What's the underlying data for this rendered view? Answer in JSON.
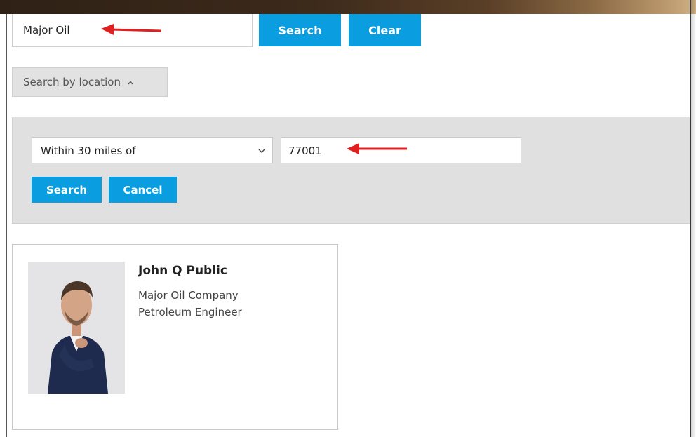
{
  "search": {
    "keyword_value": "Major Oil",
    "search_label": "Search",
    "clear_label": "Clear"
  },
  "location": {
    "toggle_label": "Search by location",
    "distance_selected": "Within 30 miles of",
    "zip_value": "77001",
    "search_label": "Search",
    "cancel_label": "Cancel"
  },
  "results": [
    {
      "name": "John Q Public",
      "company": "Major Oil Company",
      "title": "Petroleum Engineer"
    }
  ],
  "icons": {
    "toggle_icon": "caret-up-icon",
    "select_icon": "chevron-down-icon",
    "annotation_arrow": "red-arrow-icon"
  },
  "colors": {
    "primary_button": "#0a9ee0",
    "panel_background": "#e0e0e0",
    "annotation_arrow": "#e02020"
  }
}
